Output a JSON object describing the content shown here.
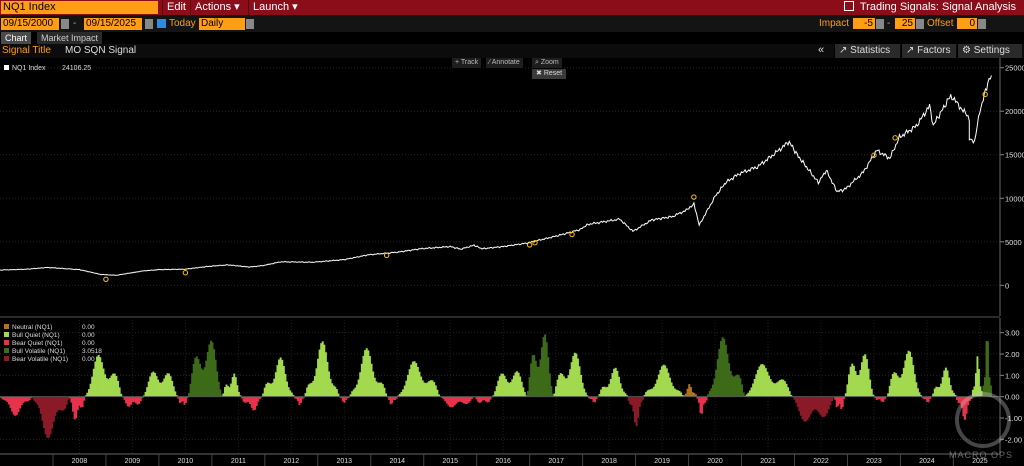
{
  "header": {
    "ticker": "NQ1 Index",
    "menus": [
      "Edit",
      "Actions ▾",
      "Launch ▾"
    ],
    "app_title": "Trading Signals: Signal Analysis"
  },
  "controls": {
    "start_date": "09/15/2000",
    "end_date": "09/15/2025",
    "today_label": "Today",
    "periodicity": "Daily",
    "impact_label": "Impact",
    "impact_low": "-5",
    "impact_high": "25",
    "offset_label": "Offset",
    "offset_value": "0"
  },
  "tabs": [
    "Chart",
    "Market Impact"
  ],
  "signal": {
    "title_label": "Signal Title",
    "title_value": "MO SQN Signal"
  },
  "right_buttons": [
    "Statistics",
    "Factors",
    "Settings"
  ],
  "tools": [
    "Track",
    "Annotate",
    "Zoom"
  ],
  "reset_label": "Reset",
  "watermark": "MACRO OPS",
  "colors": {
    "price_line": "#ffffff",
    "marker": "#ffc000",
    "neutral": "#b3731c",
    "bull_quiet": "#a3d94f",
    "bear_quiet": "#e8324b",
    "bull_volatile": "#3d6b18",
    "bear_volatile": "#8b1a28"
  },
  "chart_data": [
    {
      "type": "line",
      "legend": [
        {
          "name": "NQ1 Index",
          "value": "24106.25"
        }
      ],
      "x_ticks": [
        "2008",
        "2009",
        "2010",
        "2011",
        "2012",
        "2013",
        "2014",
        "2015",
        "2016",
        "2017",
        "2018",
        "2019",
        "2020",
        "2021",
        "2022",
        "2023",
        "2024",
        "2025"
      ],
      "y_ticks": [
        "0",
        "5000",
        "10000",
        "15000",
        "20000",
        "25000"
      ],
      "ylim": [
        -1000,
        26000
      ],
      "series": [
        {
          "name": "NQ1 Index",
          "points": [
            [
              2007.0,
              1750
            ],
            [
              2007.5,
              1850
            ],
            [
              2007.9,
              2050
            ],
            [
              2008.5,
              1800
            ],
            [
              2008.9,
              1250
            ],
            [
              2009.2,
              1150
            ],
            [
              2009.7,
              1650
            ],
            [
              2010.0,
              1800
            ],
            [
              2010.5,
              1850
            ],
            [
              2010.9,
              2150
            ],
            [
              2011.3,
              2350
            ],
            [
              2011.7,
              2100
            ],
            [
              2011.95,
              2250
            ],
            [
              2012.3,
              2700
            ],
            [
              2012.9,
              2650
            ],
            [
              2013.5,
              2950
            ],
            [
              2013.95,
              3500
            ],
            [
              2014.5,
              3800
            ],
            [
              2014.95,
              4200
            ],
            [
              2015.5,
              4450
            ],
            [
              2015.7,
              4150
            ],
            [
              2015.95,
              4600
            ],
            [
              2016.1,
              4200
            ],
            [
              2016.5,
              4450
            ],
            [
              2016.95,
              4850
            ],
            [
              2017.5,
              5650
            ],
            [
              2017.95,
              6400
            ],
            [
              2018.1,
              7000
            ],
            [
              2018.7,
              7600
            ],
            [
              2018.95,
              6200
            ],
            [
              2019.3,
              7500
            ],
            [
              2019.7,
              7900
            ],
            [
              2019.98,
              8700
            ],
            [
              2020.1,
              9400
            ],
            [
              2020.2,
              6900
            ],
            [
              2020.5,
              10200
            ],
            [
              2020.7,
              11800
            ],
            [
              2020.95,
              12800
            ],
            [
              2021.3,
              13600
            ],
            [
              2021.6,
              15000
            ],
            [
              2021.9,
              16500
            ],
            [
              2022.05,
              15000
            ],
            [
              2022.45,
              11800
            ],
            [
              2022.6,
              13200
            ],
            [
              2022.8,
              10800
            ],
            [
              2022.95,
              11000
            ],
            [
              2023.3,
              13000
            ],
            [
              2023.55,
              15500
            ],
            [
              2023.8,
              14600
            ],
            [
              2023.98,
              17000
            ],
            [
              2024.3,
              18300
            ],
            [
              2024.55,
              20600
            ],
            [
              2024.62,
              18400
            ],
            [
              2024.95,
              21800
            ],
            [
              2025.3,
              19200
            ],
            [
              2025.3,
              17000
            ],
            [
              2025.4,
              16400
            ],
            [
              2025.5,
              20000
            ],
            [
              2025.65,
              23300
            ],
            [
              2025.72,
              24106
            ]
          ]
        }
      ],
      "markers": [
        [
          2009.0,
          1150
        ],
        [
          2010.5,
          1900
        ],
        [
          2014.3,
          3900
        ],
        [
          2017.0,
          5100
        ],
        [
          2017.1,
          5350
        ],
        [
          2017.8,
          6300
        ],
        [
          2020.1,
          10600
        ],
        [
          2023.5,
          15400
        ],
        [
          2023.9,
          17400
        ],
        [
          2025.6,
          22400
        ]
      ]
    },
    {
      "type": "bar",
      "legend": [
        {
          "name": "Neutral (NQ1)",
          "value": "0.00"
        },
        {
          "name": "Bull Quiet (NQ1)",
          "value": "0.00"
        },
        {
          "name": "Bear Quiet (NQ1)",
          "value": "0.00"
        },
        {
          "name": "Bull Volatile (NQ1)",
          "value": "3.0518"
        },
        {
          "name": "Bear Volatile (NQ1)",
          "value": "0.00"
        }
      ],
      "y_ticks": [
        "-2.00",
        "-1.00",
        "0.00",
        "1.00",
        "2.00",
        "3.00"
      ],
      "ylim": [
        -2.5,
        3.5
      ],
      "segments": [
        {
          "start": 2007.0,
          "end": 2007.6,
          "peak": -0.9,
          "regime": "bear_quiet"
        },
        {
          "start": 2007.6,
          "end": 2008.3,
          "peak": -2.0,
          "regime": "bear_volatile"
        },
        {
          "start": 2008.3,
          "end": 2008.6,
          "peak": -1.2,
          "regime": "bear_quiet"
        },
        {
          "start": 2008.6,
          "end": 2009.3,
          "peak": 2.2,
          "regime": "bull_quiet"
        },
        {
          "start": 2009.3,
          "end": 2009.7,
          "peak": -0.6,
          "regime": "bear_quiet"
        },
        {
          "start": 2009.7,
          "end": 2010.35,
          "peak": 1.6,
          "regime": "bull_quiet"
        },
        {
          "start": 2010.35,
          "end": 2010.55,
          "peak": -0.5,
          "regime": "bear_quiet"
        },
        {
          "start": 2010.55,
          "end": 2011.2,
          "peak": 3.2,
          "regime": "bull_volatile"
        },
        {
          "start": 2011.2,
          "end": 2011.55,
          "peak": 1.2,
          "regime": "bull_quiet"
        },
        {
          "start": 2011.55,
          "end": 2011.95,
          "peak": -0.7,
          "regime": "bear_quiet"
        },
        {
          "start": 2011.95,
          "end": 2012.55,
          "peak": 1.9,
          "regime": "bull_quiet"
        },
        {
          "start": 2012.55,
          "end": 2012.75,
          "peak": -0.4,
          "regime": "bear_quiet"
        },
        {
          "start": 2012.75,
          "end": 2013.4,
          "peak": 2.6,
          "regime": "bull_quiet"
        },
        {
          "start": 2013.4,
          "end": 2013.6,
          "peak": -0.3,
          "regime": "bear_quiet"
        },
        {
          "start": 2013.6,
          "end": 2014.3,
          "peak": 2.3,
          "regime": "bull_quiet"
        },
        {
          "start": 2014.3,
          "end": 2014.5,
          "peak": -0.4,
          "regime": "bear_quiet"
        },
        {
          "start": 2014.5,
          "end": 2015.3,
          "peak": 1.8,
          "regime": "bull_quiet"
        },
        {
          "start": 2015.3,
          "end": 2015.95,
          "peak": -0.6,
          "regime": "bear_quiet"
        },
        {
          "start": 2015.95,
          "end": 2016.3,
          "peak": -0.4,
          "regime": "bear_quiet"
        },
        {
          "start": 2016.3,
          "end": 2016.95,
          "peak": 1.6,
          "regime": "bull_quiet"
        },
        {
          "start": 2016.95,
          "end": 2017.45,
          "peak": 3.5,
          "regime": "bull_volatile"
        },
        {
          "start": 2017.45,
          "end": 2018.1,
          "peak": 2.3,
          "regime": "bull_quiet"
        },
        {
          "start": 2018.1,
          "end": 2018.3,
          "peak": -0.3,
          "regime": "bear_quiet"
        },
        {
          "start": 2018.3,
          "end": 2018.85,
          "peak": 1.4,
          "regime": "bull_quiet"
        },
        {
          "start": 2018.85,
          "end": 2019.15,
          "peak": -1.4,
          "regime": "bear_volatile"
        },
        {
          "start": 2019.15,
          "end": 2019.9,
          "peak": 1.5,
          "regime": "bull_quiet"
        },
        {
          "start": 2019.9,
          "end": 2020.15,
          "peak": 0.6,
          "regime": "neutral"
        },
        {
          "start": 2020.15,
          "end": 2020.35,
          "peak": -0.9,
          "regime": "bear_quiet"
        },
        {
          "start": 2020.35,
          "end": 2021.05,
          "peak": 2.9,
          "regime": "bull_volatile"
        },
        {
          "start": 2021.05,
          "end": 2021.95,
          "peak": 1.7,
          "regime": "bull_quiet"
        },
        {
          "start": 2021.95,
          "end": 2022.75,
          "peak": -1.5,
          "regime": "bear_volatile"
        },
        {
          "start": 2022.75,
          "end": 2022.95,
          "peak": -0.8,
          "regime": "bear_quiet"
        },
        {
          "start": 2022.95,
          "end": 2023.5,
          "peak": 2.5,
          "regime": "bull_quiet"
        },
        {
          "start": 2023.5,
          "end": 2023.75,
          "peak": -0.3,
          "regime": "bear_quiet"
        },
        {
          "start": 2023.75,
          "end": 2024.4,
          "peak": 2.4,
          "regime": "bull_quiet"
        },
        {
          "start": 2024.4,
          "end": 2024.6,
          "peak": -0.3,
          "regime": "bear_quiet"
        },
        {
          "start": 2024.6,
          "end": 2025.05,
          "peak": 1.4,
          "regime": "bull_quiet"
        },
        {
          "start": 2025.05,
          "end": 2025.35,
          "peak": -1.1,
          "regime": "bear_quiet"
        },
        {
          "start": 2025.35,
          "end": 2025.55,
          "peak": 1.9,
          "regime": "bull_quiet"
        },
        {
          "start": 2025.55,
          "end": 2025.72,
          "peak": 3.05,
          "regime": "bull_volatile"
        }
      ]
    }
  ]
}
